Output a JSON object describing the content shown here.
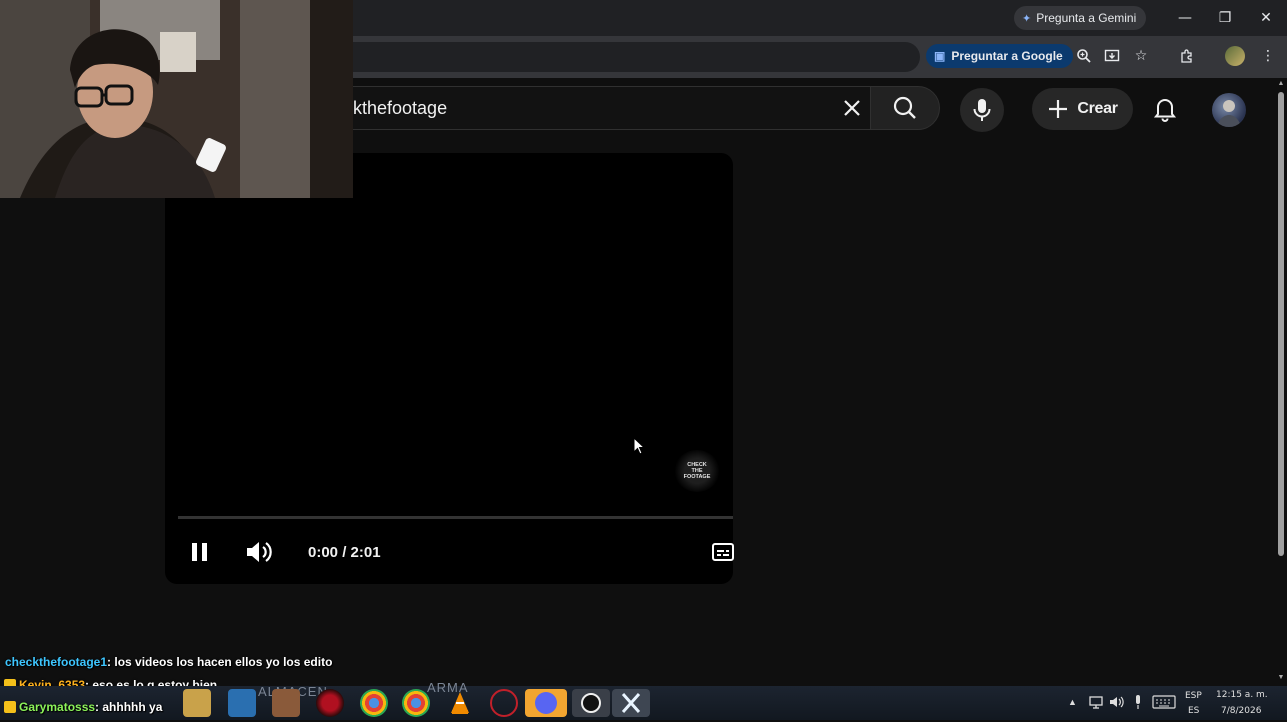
{
  "browser": {
    "gemini_label": "Pregunta a Gemini",
    "lens_label": "Preguntar a Google",
    "window_controls": [
      "minimize-icon",
      "restore-icon",
      "close-icon"
    ],
    "toolbar_icons": [
      "zoom-icon",
      "install-app-icon",
      "star-icon",
      "extensions-icon",
      "profile-icon",
      "menu-icon"
    ]
  },
  "youtube": {
    "search_query": "kthefootage",
    "create_label": "Crear",
    "colors": {
      "background": "#0f0f0f",
      "progress": "#ff0000"
    }
  },
  "player": {
    "time": "0:00 / 2:01",
    "progress_fraction": 0,
    "watermark_text": "CHECK THE FOOTAGE",
    "state": "playing"
  },
  "chat": [
    {
      "user": "checkthefootage1",
      "message": " : los videos los hacen ellos yo los edito",
      "badge": false
    },
    {
      "user": "Kevin_6353",
      "message": " : eso es lo q estoy bien",
      "badge": true
    },
    {
      "user": "Garymatosss",
      "message": " : ahhhhh ya",
      "badge": true
    }
  ],
  "taskbar": {
    "background_labels": [
      "ALMACEN",
      "ARMA"
    ],
    "lang_top": "ESP",
    "lang_bottom": "ES",
    "clock_time": "12:15 a. m.",
    "clock_date": "7/8/2026"
  }
}
